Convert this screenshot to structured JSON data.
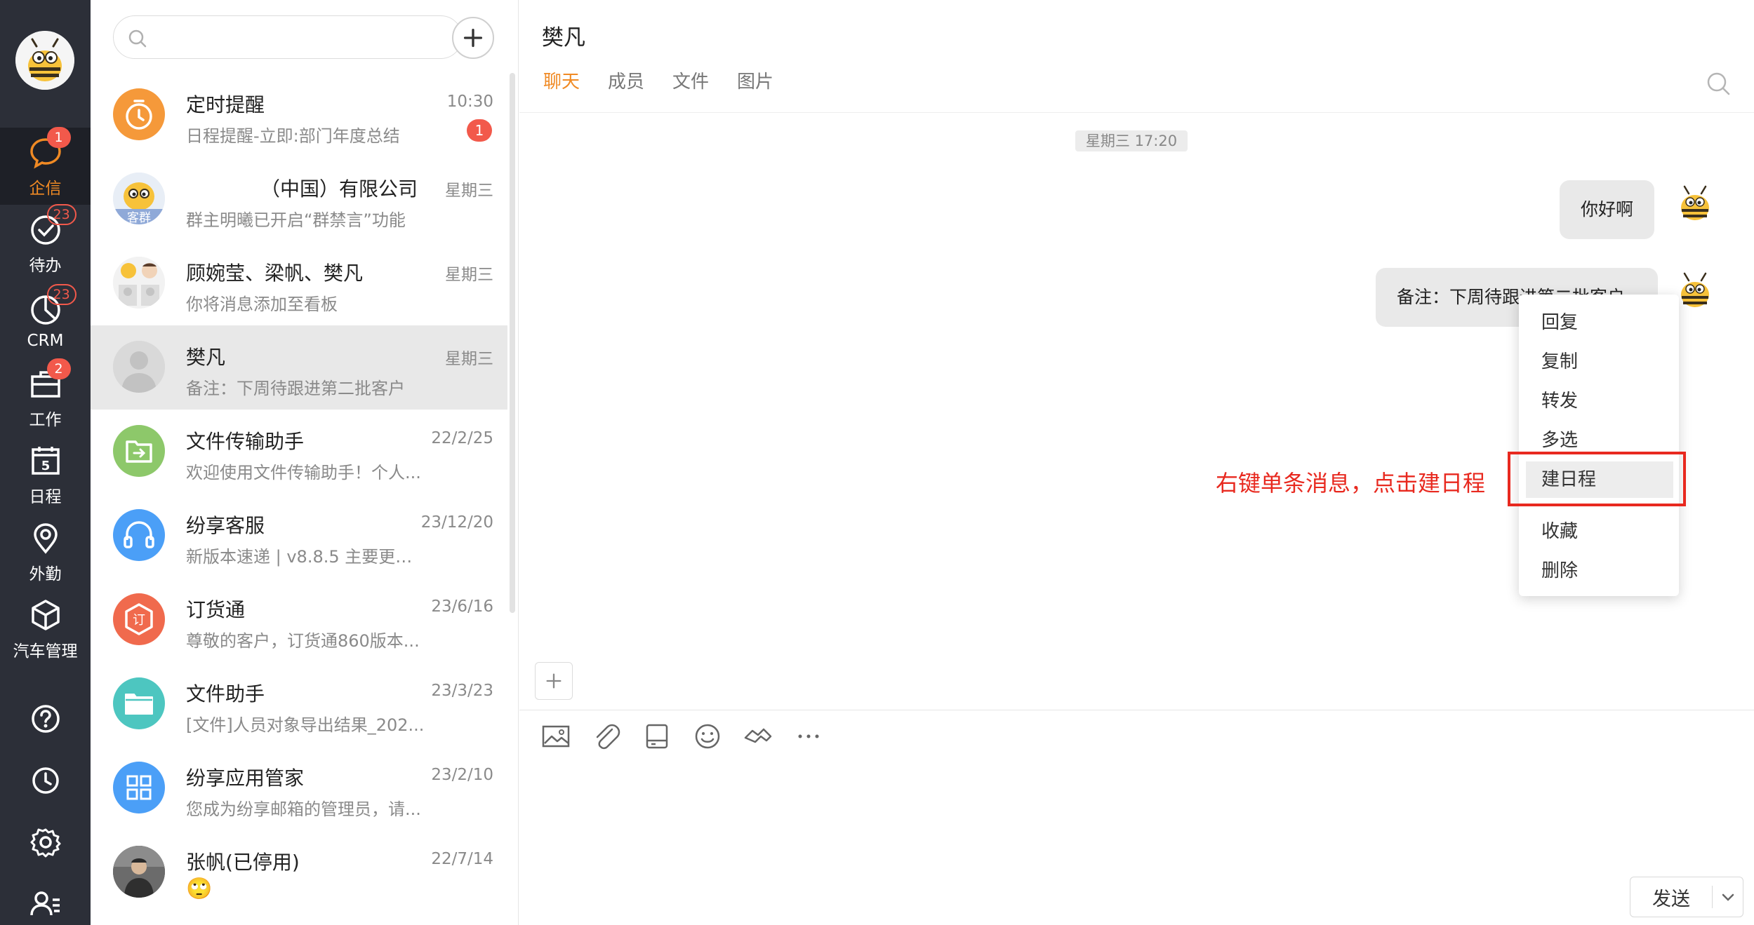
{
  "nav": {
    "items": [
      {
        "label": "企信",
        "badge": "1"
      },
      {
        "label": "待办",
        "badge": "23"
      },
      {
        "label": "CRM",
        "badge": "23"
      },
      {
        "label": "工作",
        "badge": "2"
      },
      {
        "label": "日程",
        "calendar_day": "5"
      },
      {
        "label": "外勤"
      },
      {
        "label": "汽车管理"
      }
    ],
    "bottom_icons": [
      "help-icon",
      "clock-icon",
      "settings-icon",
      "user-list-icon"
    ]
  },
  "search": {
    "value": "",
    "placeholder": ""
  },
  "conversations": [
    {
      "name": "定时提醒",
      "time": "10:30",
      "preview": "日程提醒-立即:部门年度总结",
      "badge": "1",
      "avatar": "alarm-clock-icon",
      "avatar_color": "#f5993a"
    },
    {
      "name": "（中国）有限公司",
      "time": "星期三",
      "preview": "群主明曦已开启“群禁言”功能",
      "avatar": "group-avatar",
      "avatar_tag": "客群"
    },
    {
      "name": "顾婉莹、梁帆、樊凡",
      "time": "星期三",
      "preview": "你将消息添加至看板",
      "avatar": "multi-user-avatar"
    },
    {
      "name": "樊凡",
      "time": "星期三",
      "preview": "备注：下周待跟进第二批客户",
      "avatar": "default-user-avatar"
    },
    {
      "name": "文件传输助手",
      "time": "22/2/25",
      "preview": "欢迎使用文件传输助手！个人...",
      "avatar": "file-transfer-icon",
      "avatar_color": "#8dc86a"
    },
    {
      "name": "纷享客服",
      "time": "23/12/20",
      "preview": "新版本速递 | v8.8.5 主要更新...",
      "avatar": "headset-icon",
      "avatar_color": "#4b9ff7"
    },
    {
      "name": "订货通",
      "time": "23/6/16",
      "preview": "尊敬的客户，订货通860版本...",
      "avatar": "order-icon",
      "avatar_color": "#f06a4d"
    },
    {
      "name": "文件助手",
      "time": "23/3/23",
      "preview": "[文件]人员对象导出结果_202...",
      "avatar": "folder-icon",
      "avatar_color": "#4dc6c0"
    },
    {
      "name": "纷享应用管家",
      "time": "23/2/10",
      "preview": "您成为纷享邮箱的管理员，请...",
      "avatar": "apps-grid-icon",
      "avatar_color": "#4b9ff7"
    },
    {
      "name": "张帆(已停用)",
      "time": "22/7/14",
      "preview": "🙄",
      "avatar": "photo-avatar"
    }
  ],
  "chat": {
    "title": "樊凡",
    "tabs": [
      "聊天",
      "成员",
      "文件",
      "图片"
    ],
    "active_tab": "聊天",
    "timestamp": "星期三 17:20",
    "messages": [
      {
        "text": "你好啊"
      },
      {
        "text": "备注：下周待跟进第二批客户"
      }
    ],
    "annotation": "右键单条消息，点击建日程",
    "context_menu": [
      "回复",
      "复制",
      "转发",
      "多选",
      "建日程",
      "收藏",
      "删除"
    ],
    "highlighted_menu_item": "建日程",
    "toolbar_icons": [
      "image-icon",
      "attachment-icon",
      "disk-icon",
      "emoji-icon",
      "handshake-icon",
      "more-icon"
    ],
    "send_label": "发送"
  },
  "colors": {
    "accent": "#f08a24",
    "nav_bg": "#2c2f38",
    "badge": "#f2594b",
    "annotation": "#e8291f"
  }
}
